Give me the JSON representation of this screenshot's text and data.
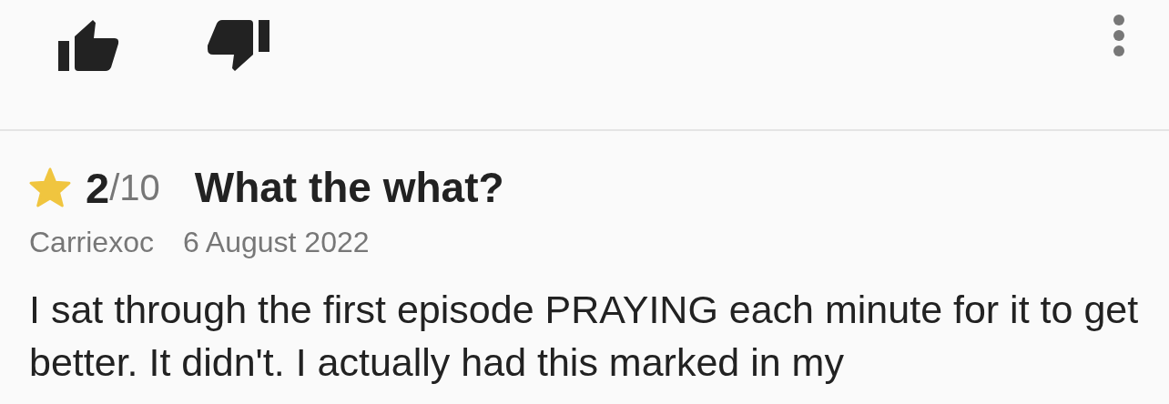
{
  "rating": {
    "score": "2",
    "scale": "/10"
  },
  "review": {
    "title": "What the what?",
    "author": "Carriexoc",
    "date": "6 August 2022",
    "text": "I sat through the first episode PRAYING each minute for it to get better. It didn't. I actually had this marked in my"
  }
}
